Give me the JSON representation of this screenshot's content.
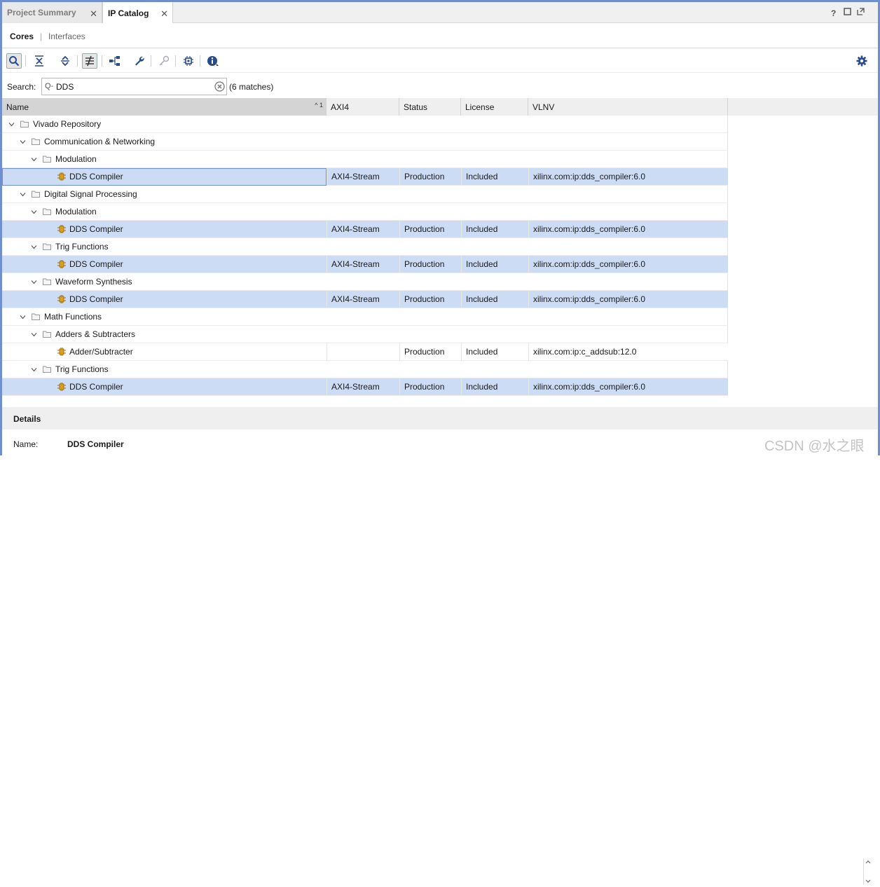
{
  "tabs": [
    {
      "label": "Project Summary",
      "active": false
    },
    {
      "label": "IP Catalog",
      "active": true
    }
  ],
  "window_controls": {
    "help": "?"
  },
  "subtabs": {
    "cores": "Cores",
    "separator": "|",
    "interfaces": "Interfaces"
  },
  "search": {
    "label": "Search:",
    "value": "DDS",
    "prefix": "Q-",
    "matches": "(6 matches)"
  },
  "table": {
    "columns": [
      {
        "label": "Name",
        "sort": "1"
      },
      {
        "label": "AXI4"
      },
      {
        "label": "Status"
      },
      {
        "label": "License"
      },
      {
        "label": "VLNV"
      }
    ],
    "rows": [
      {
        "name": "Vivado Repository",
        "level": 0,
        "kind": "folder"
      },
      {
        "name": "Communication & Networking",
        "level": 1,
        "kind": "folder"
      },
      {
        "name": "Modulation",
        "level": 2,
        "kind": "folder"
      },
      {
        "name": "DDS Compiler",
        "level": 3,
        "kind": "ip",
        "axi4": "AXI4-Stream",
        "status": "Production",
        "license": "Included",
        "vlnv": "xilinx.com:ip:dds_compiler:6.0",
        "highlight": true,
        "focused": true
      },
      {
        "name": "Digital Signal Processing",
        "level": 1,
        "kind": "folder"
      },
      {
        "name": "Modulation",
        "level": 2,
        "kind": "folder"
      },
      {
        "name": "DDS Compiler",
        "level": 3,
        "kind": "ip",
        "axi4": "AXI4-Stream",
        "status": "Production",
        "license": "Included",
        "vlnv": "xilinx.com:ip:dds_compiler:6.0",
        "highlight": true
      },
      {
        "name": "Trig Functions",
        "level": 2,
        "kind": "folder"
      },
      {
        "name": "DDS Compiler",
        "level": 3,
        "kind": "ip",
        "axi4": "AXI4-Stream",
        "status": "Production",
        "license": "Included",
        "vlnv": "xilinx.com:ip:dds_compiler:6.0",
        "highlight": true
      },
      {
        "name": "Waveform Synthesis",
        "level": 2,
        "kind": "folder"
      },
      {
        "name": "DDS Compiler",
        "level": 3,
        "kind": "ip",
        "axi4": "AXI4-Stream",
        "status": "Production",
        "license": "Included",
        "vlnv": "xilinx.com:ip:dds_compiler:6.0",
        "highlight": true
      },
      {
        "name": "Math Functions",
        "level": 1,
        "kind": "folder"
      },
      {
        "name": "Adders & Subtracters",
        "level": 2,
        "kind": "folder"
      },
      {
        "name": "Adder/Subtracter",
        "level": 3,
        "kind": "ip",
        "axi4": "",
        "status": "Production",
        "license": "Included",
        "vlnv": "xilinx.com:ip:c_addsub:12.0",
        "highlight": false
      },
      {
        "name": "Trig Functions",
        "level": 2,
        "kind": "folder"
      },
      {
        "name": "DDS Compiler",
        "level": 3,
        "kind": "ip",
        "axi4": "AXI4-Stream",
        "status": "Production",
        "license": "Included",
        "vlnv": "xilinx.com:ip:dds_compiler:6.0",
        "highlight": true
      }
    ]
  },
  "details": {
    "title": "Details",
    "name_label": "Name:",
    "name_value": "DDS Compiler"
  },
  "watermark": "CSDN @水之眼",
  "colors": {
    "accent": "#6f8fd0",
    "highlight": "#ccdcf5",
    "ip_icon": "#d9a020"
  }
}
